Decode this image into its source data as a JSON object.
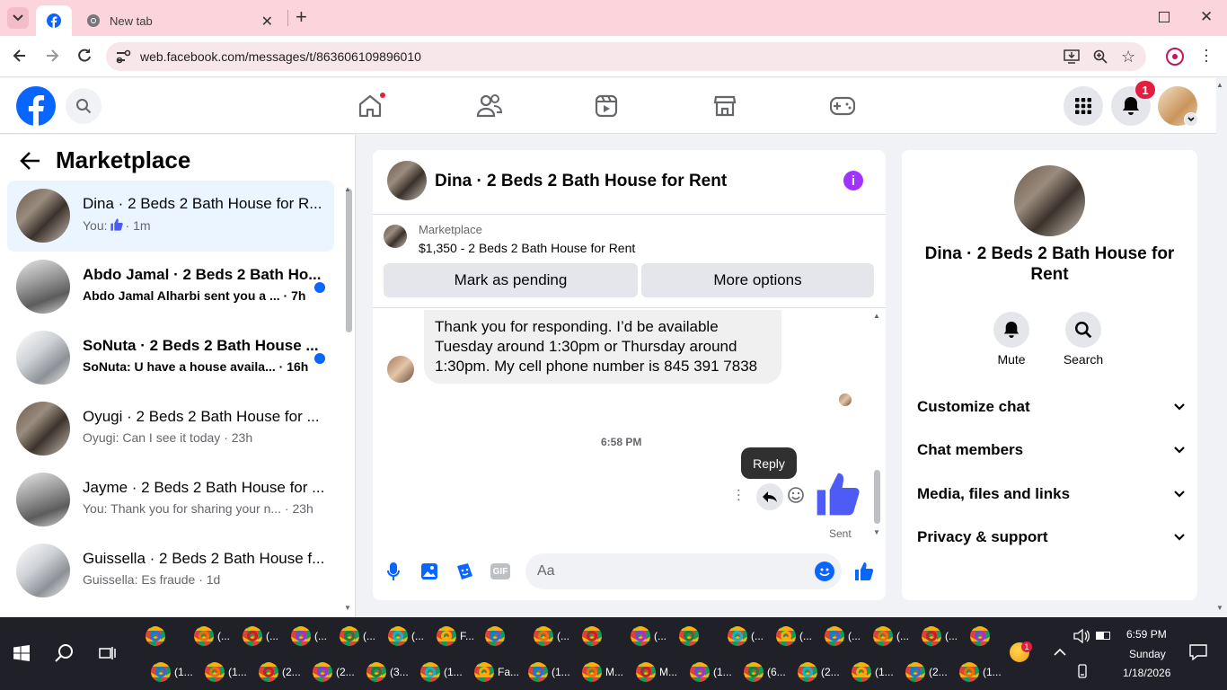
{
  "browser": {
    "tab_new_label": "New tab",
    "url": "web.facebook.com/messages/t/863606109896010"
  },
  "fb": {
    "notifications_count": "1"
  },
  "left": {
    "title": "Marketplace",
    "conversations": [
      {
        "name": "Dina · 2 Beds 2 Bath House for R...",
        "preview": "You:",
        "time": "· 1m",
        "selected": true,
        "unread": false
      },
      {
        "name": "Abdo Jamal · 2 Beds 2 Bath Ho...",
        "preview": "Abdo Jamal Alharbi sent you a ...",
        "time": "· 7h",
        "unread": true
      },
      {
        "name": "SoNuta · 2 Beds 2 Bath House ...",
        "preview": "SoNuta: U have a house availa...",
        "time": "· 16h",
        "unread": true
      },
      {
        "name": "Oyugi · 2 Beds 2 Bath House for ...",
        "preview": "Oyugi: Can I see it today",
        "time": "· 23h",
        "unread": false
      },
      {
        "name": "Jayme · 2 Beds 2 Bath House for ...",
        "preview": "You: Thank you for sharing your n...",
        "time": "· 23h",
        "unread": false
      },
      {
        "name": "Guissella · 2 Beds 2 Bath House f...",
        "preview": "Guissella: Es fraude",
        "time": "· 1d",
        "unread": false
      }
    ]
  },
  "chat": {
    "header_title": "Dina · 2 Beds 2 Bath House for Rent",
    "listing_source": "Marketplace",
    "listing_title": "$1,350 - 2 Beds 2 Bath House for Rent",
    "mark_pending": "Mark as pending",
    "more_options": "More options",
    "message_text": "Thank you for responding.  I’d be available Tuesday around 1:30pm or Thursday around 1:30pm. My cell phone number is 845 391 7838",
    "timestamp": "6:58 PM",
    "tooltip": "Reply",
    "sent_label": "Sent",
    "input_placeholder": "Aa"
  },
  "right": {
    "name": "Dina · 2 Beds 2 Bath House for Rent",
    "mute_label": "Mute",
    "search_label": "Search",
    "sections": [
      "Customize chat",
      "Chat members",
      "Media, files and links",
      "Privacy & support"
    ]
  },
  "taskbar": {
    "row1_labels": [
      "",
      "(...",
      "(...",
      "(...",
      "(...",
      "(...",
      "F...",
      "",
      "(...",
      "",
      "(...",
      "",
      "(...",
      "(...",
      "(...",
      "(...",
      "(...",
      ""
    ],
    "row2_labels": [
      "(1...",
      "(1...",
      "(2...",
      "(2...",
      "(3...",
      "(1...",
      "Fa...",
      "(1...",
      "M...",
      "M...",
      "(1...",
      "(6...",
      "(2...",
      "(1...",
      "(2...",
      "(1..."
    ],
    "time": "6:59 PM",
    "day": "Sunday",
    "date": "1/18/2026",
    "weather_badge": "1"
  },
  "colors": {
    "tabbar": "#fbd4dc",
    "fb_blue": "#0866ff",
    "like_blue": "#4c5cf5",
    "unread_dot": "#0866ff",
    "notification_red": "#e41e3f"
  }
}
